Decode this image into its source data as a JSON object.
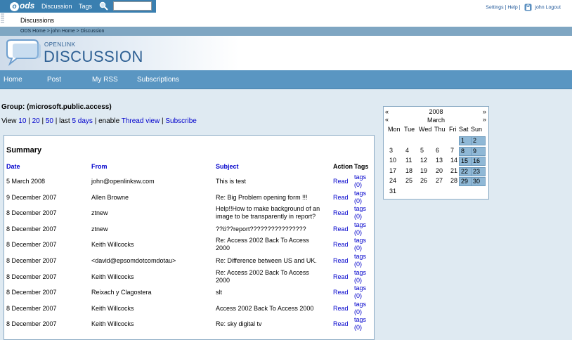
{
  "topbar": {
    "logo": "ods",
    "nav": [
      "Discussion",
      "Tags"
    ],
    "search_placeholder": "",
    "subnav": "Discussions",
    "settings": "Settings",
    "help": "Help",
    "separator": "|",
    "logout": "john Logout"
  },
  "breadcrumb": "ODS Home > john Home > Discussion",
  "banner": {
    "small": "OPENLINK",
    "big": "DISCUSSION"
  },
  "mainnav": [
    "Home",
    "Post",
    "My RSS",
    "Subscriptions"
  ],
  "group": {
    "title": "Group: (microsoft.public.access)"
  },
  "view": {
    "prefix": "View",
    "options": [
      "10",
      "20",
      "50"
    ],
    "last_prefix": "| last",
    "last_link": "5 days",
    "enable_prefix": "| enable",
    "thread_view": "Thread view",
    "subscribe": "Subscribe"
  },
  "calendar": {
    "prev_year": "«",
    "year": "2008",
    "next_year": "»",
    "prev_month": "«",
    "month": "March",
    "next_month": "»",
    "dow": [
      "Mon",
      "Tue",
      "Wed",
      "Thu",
      "Fri",
      "Sat",
      "Sun"
    ],
    "weeks": [
      [
        "",
        "",
        "",
        "",
        "",
        "1",
        "2"
      ],
      [
        "3",
        "4",
        "5",
        "6",
        "7",
        "8",
        "9"
      ],
      [
        "10",
        "11",
        "12",
        "13",
        "14",
        "15",
        "16"
      ],
      [
        "17",
        "18",
        "19",
        "20",
        "21",
        "22",
        "23"
      ],
      [
        "24",
        "25",
        "26",
        "27",
        "28",
        "29",
        "30"
      ],
      [
        "31",
        "",
        "",
        "",
        "",
        "",
        ""
      ]
    ],
    "highlighted": [
      "1",
      "2",
      "8",
      "9",
      "15",
      "16",
      "22",
      "23",
      "29",
      "30"
    ],
    "highlight_color": "#8fb8d6"
  },
  "summary": {
    "title": "Summary",
    "headers": {
      "date": "Date",
      "from": "From",
      "subject": "Subject",
      "action": "Action",
      "tags": "Tags"
    },
    "rows": [
      {
        "date": "5 March 2008",
        "from": "john@openlinksw.com",
        "subject": [
          "This is test"
        ],
        "action": "Read",
        "tags": [
          "tags",
          "(0)"
        ]
      },
      {
        "date": "9 December 2007",
        "from": "Allen Browne",
        "subject": [
          "Re: Big Problem opening form !!!"
        ],
        "action": "Read",
        "tags": [
          "tags",
          "(0)"
        ]
      },
      {
        "date": "8 December 2007",
        "from": "ztnew",
        "subject": [
          "Help!!How to make background of an",
          "image to be transparently in report?"
        ],
        "action": "Read",
        "tags": [
          "tags",
          "(0)"
        ]
      },
      {
        "date": "8 December 2007",
        "from": "ztnew",
        "subject": [
          "??ö??report????????????????"
        ],
        "action": "Read",
        "tags": [
          "tags",
          "(0)"
        ]
      },
      {
        "date": "8 December 2007",
        "from": "Keith Willcocks",
        "subject": [
          "Re: Access 2002 Back To Access",
          "2000"
        ],
        "action": "Read",
        "tags": [
          "tags",
          "(0)"
        ]
      },
      {
        "date": "8 December 2007",
        "from": "<david@epsomdotcomdotau>",
        "subject": [
          "Re: Difference between US and UK."
        ],
        "action": "Read",
        "tags": [
          "tags",
          "(0)"
        ]
      },
      {
        "date": "8 December 2007",
        "from": "Keith Willcocks",
        "subject": [
          "Re: Access 2002 Back To Access",
          "2000"
        ],
        "action": "Read",
        "tags": [
          "tags",
          "(0)"
        ]
      },
      {
        "date": "8 December 2007",
        "from": "Reixach y Clagostera",
        "subject": [
          "slt"
        ],
        "action": "Read",
        "tags": [
          "tags",
          "(0)"
        ]
      },
      {
        "date": "8 December 2007",
        "from": "Keith Willcocks",
        "subject": [
          "Access 2002 Back To Access 2000"
        ],
        "action": "Read",
        "tags": [
          "tags",
          "(0)"
        ]
      },
      {
        "date": "8 December 2007",
        "from": "Keith Willcocks",
        "subject": [
          "Re: sky digital tv"
        ],
        "action": "Read",
        "tags": [
          "tags",
          "(0)"
        ]
      }
    ]
  },
  "colors": {
    "nav_bar": "#5a96c2",
    "breadcrumb": "#7fa6c2",
    "link": "#0000cc",
    "page_bg": "#dfeaf2"
  }
}
